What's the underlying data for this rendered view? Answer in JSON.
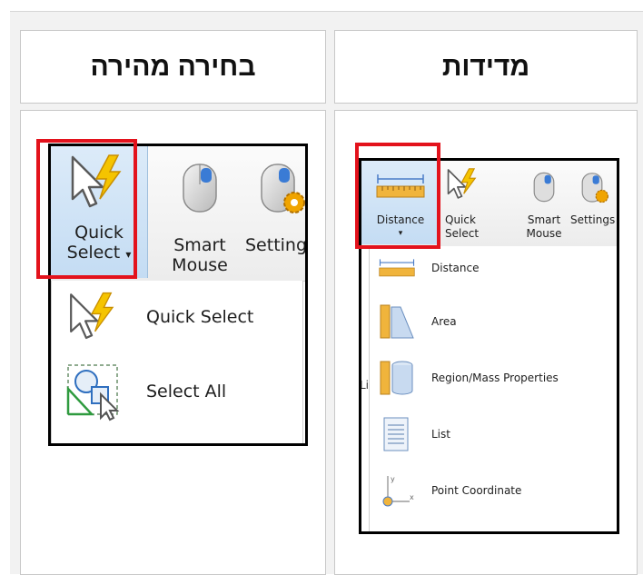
{
  "headers": {
    "left": "בחירה מהירה",
    "right": "מדידות"
  },
  "left_screenshot": {
    "quick_select_label_line1": "Quick",
    "quick_select_label_line2": "Select",
    "dropdown_arrow": "▾",
    "smart_mouse_line1": "Smart",
    "smart_mouse_line2": "Mouse",
    "settings_label": "Setting",
    "menu_items": [
      "Quick Select",
      "Select All"
    ]
  },
  "right_screenshot": {
    "distance_label": "Distance",
    "dropdown_arrow": "▾",
    "quick_label_line1": "Quick",
    "quick_label_line2": "Select",
    "smart_mouse_line1": "Smart",
    "smart_mouse_line2": "Mouse",
    "settings_label": "Settings",
    "menu_items": [
      "Distance",
      "Area",
      "Region/Mass Properties",
      "List",
      "Point Coordinate"
    ],
    "edge_letter": "Li"
  },
  "colors": {
    "highlight_red": "#e3121c",
    "ribbon_selected": "#cfe3f7",
    "lightning": "#f5c400",
    "ruler": "#f0b43c"
  },
  "icons": [
    "quick-select-icon",
    "smart-mouse-icon",
    "settings-icon",
    "select-all-icon",
    "distance-icon",
    "area-icon",
    "region-mass-icon",
    "list-icon",
    "point-coordinate-icon"
  ]
}
